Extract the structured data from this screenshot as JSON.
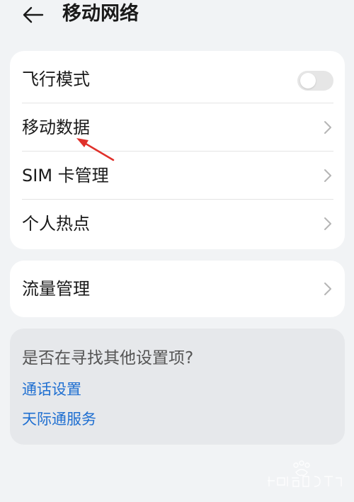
{
  "header": {
    "title": "移动网络",
    "back_icon": "arrow-left-icon"
  },
  "network_card": {
    "airplane_mode": {
      "label": "飞行模式",
      "toggle_on": false
    },
    "mobile_data": {
      "label": "移动数据"
    },
    "sim_management": {
      "label": "SIM 卡管理"
    },
    "hotspot": {
      "label": "个人热点"
    }
  },
  "traffic_card": {
    "traffic_management": {
      "label": "流量管理"
    }
  },
  "search_card": {
    "title": "是否在寻找其他设置项?",
    "links": [
      "通话设置",
      "天际通服务"
    ]
  },
  "colors": {
    "background": "#f1f3f5",
    "card": "#ffffff",
    "search_card": "#e6e8eb",
    "link": "#1f6fd1",
    "annotation_arrow": "#e0302a"
  }
}
